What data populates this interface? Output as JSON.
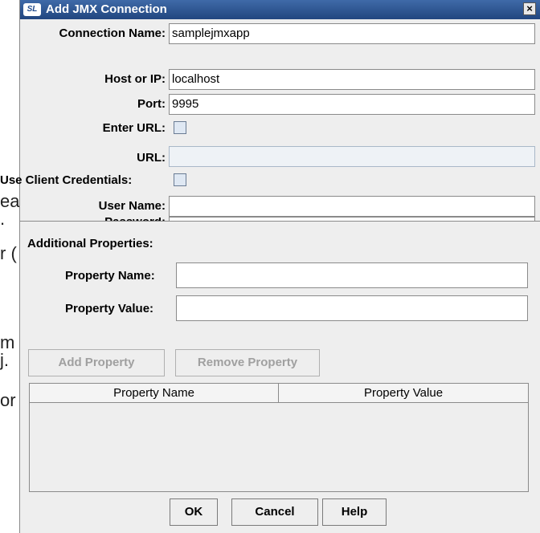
{
  "background_fragments": [
    "ea",
    ".",
    "r (",
    "m",
    "j.",
    "or"
  ],
  "dialog": {
    "title": "Add JMX Connection",
    "icon_text": "SL",
    "close_glyph": "×"
  },
  "form": {
    "connection_name": {
      "label": "Connection Name:",
      "value": "samplejmxapp"
    },
    "host": {
      "label": "Host or IP:",
      "value": "localhost"
    },
    "port": {
      "label": "Port:",
      "value": "9995"
    },
    "enter_url": {
      "label": "Enter URL:"
    },
    "url": {
      "label": "URL:",
      "value": ""
    },
    "use_client_credentials": {
      "label": "Use Client Credentials:"
    },
    "user_name": {
      "label": "User Name:",
      "value": ""
    },
    "password": {
      "label": "Password:",
      "value": ""
    }
  },
  "additional": {
    "heading": "Additional Properties:",
    "property_name": {
      "label": "Property Name:",
      "value": ""
    },
    "property_value": {
      "label": "Property Value:",
      "value": ""
    },
    "add_label": "Add Property",
    "remove_label": "Remove Property",
    "table_headers": [
      "Property Name",
      "Property Value"
    ]
  },
  "footer": {
    "ok": "OK",
    "cancel": "Cancel",
    "help": "Help"
  },
  "colors": {
    "titlebar": "#2b5592",
    "panel": "#eeeeee"
  }
}
